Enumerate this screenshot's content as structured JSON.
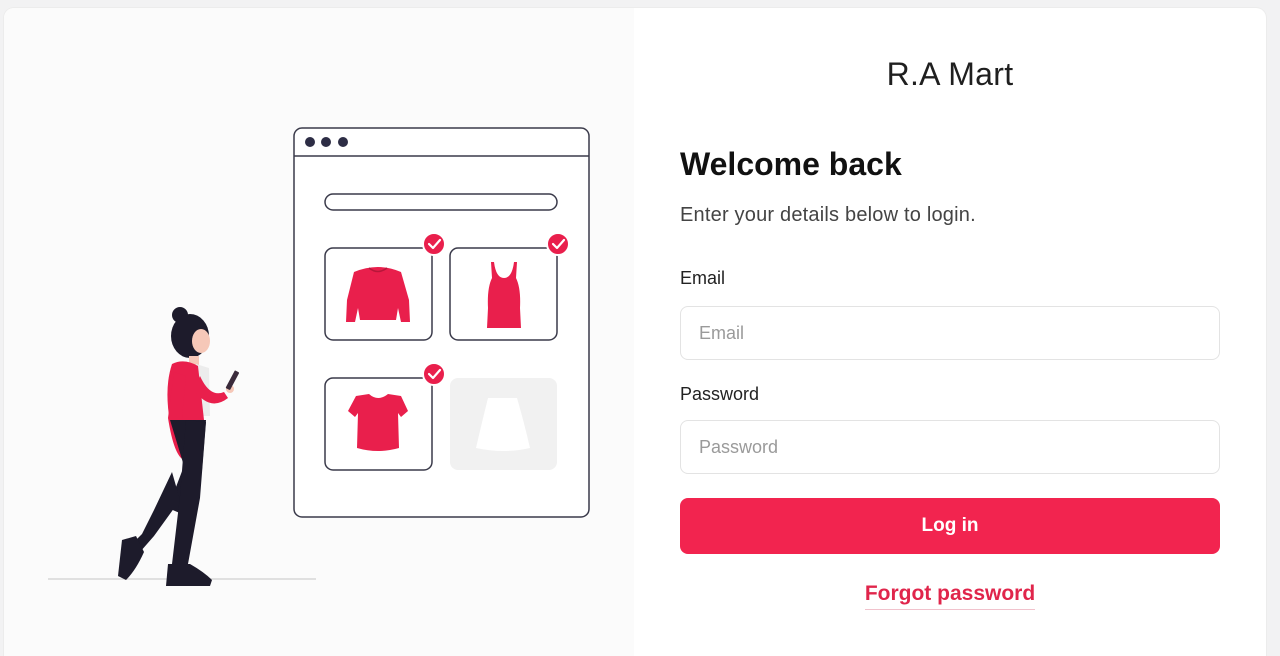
{
  "brand": {
    "name": "R.A Mart"
  },
  "login": {
    "title": "Welcome back",
    "subtitle": "Enter your details below to login.",
    "email_label": "Email",
    "email_placeholder": "Email",
    "email_value": "",
    "password_label": "Password",
    "password_placeholder": "Password",
    "password_value": "",
    "submit_label": "Log in",
    "forgot_label": "Forgot password"
  },
  "illustration": {
    "products": [
      "sweater-icon",
      "tank-top-icon",
      "crop-top-icon",
      "skirt-icon"
    ],
    "checked": [
      true,
      true,
      true,
      false
    ]
  },
  "colors": {
    "accent": "#f2244f",
    "link": "#e0254b",
    "product": "#e91f4c",
    "outline": "#3a3a4a"
  }
}
